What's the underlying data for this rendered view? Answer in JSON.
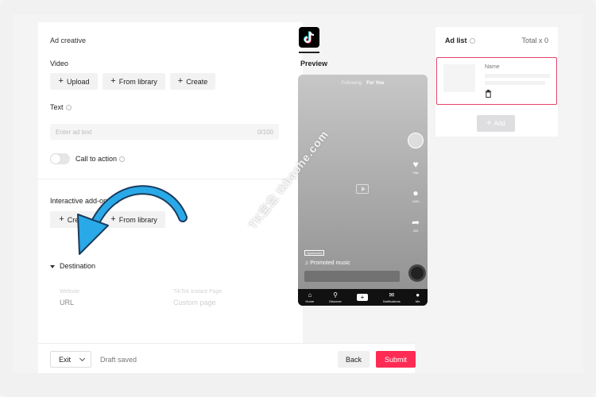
{
  "left": {
    "section_title": "Ad creative",
    "video_label": "Video",
    "video_buttons": [
      "Upload",
      "From library",
      "Create"
    ],
    "text_label": "Text",
    "text_placeholder": "Enter ad text",
    "text_counter": "0/100",
    "cta_label": "Call to action",
    "addons_label": "Interactive add-ons",
    "addons_buttons": [
      "Create",
      "From library"
    ],
    "destination_label": "Destination",
    "website_label": "Website",
    "website_value": "URL",
    "instant_label": "TikTok Instant Page",
    "instant_value": "Custom page"
  },
  "bottom": {
    "exit_label": "Exit",
    "draft_status": "Draft saved",
    "back_label": "Back",
    "submit_label": "Submit"
  },
  "preview": {
    "title": "Preview",
    "following": "Following",
    "for_you": "For You",
    "sponsored": "Sponsored",
    "music": "♫ Promoted music",
    "like_count": "Title",
    "comment_count": "1000",
    "share_count": "333",
    "nav": [
      "Home",
      "Discover",
      "",
      "Notifications",
      "Me"
    ]
  },
  "adlist": {
    "title": "Ad list",
    "total": "Total x 0",
    "name_label": "Name",
    "add_label": "Add"
  },
  "watermark": "TK宝盒  tkbaohe.com",
  "colors": {
    "accent": "#fe2c55",
    "arrow": "#2aa9e8",
    "card_border": "#e5446b"
  }
}
